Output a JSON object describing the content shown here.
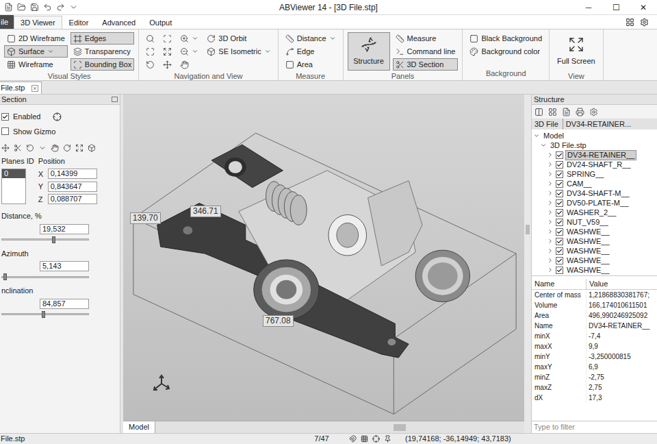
{
  "window": {
    "title": "ABViewer 14 - [3D File.stp]",
    "controls": [
      "─",
      "☐",
      "✕"
    ]
  },
  "tabs": [
    {
      "label": "ile",
      "selected": false,
      "kind": "file"
    },
    {
      "label": "3D Viewer",
      "selected": true,
      "kind": "tab"
    },
    {
      "label": "Editor",
      "selected": false,
      "kind": "tab"
    },
    {
      "label": "Advanced",
      "selected": false,
      "kind": "tab"
    },
    {
      "label": "Output",
      "selected": false,
      "kind": "tab"
    }
  ],
  "ribbon": [
    {
      "label": "Visual Styles",
      "columns": [
        [
          {
            "kind": "small",
            "label": "2D Wireframe",
            "selected": false,
            "dropdown": false
          },
          {
            "kind": "small",
            "label": "Surface",
            "selected": true,
            "dropdown": true
          },
          {
            "kind": "small",
            "label": "Wireframe",
            "selected": false,
            "dropdown": false
          }
        ],
        [
          {
            "kind": "small",
            "label": "Edges",
            "selected": true,
            "dropdown": false
          },
          {
            "kind": "small",
            "label": "Transparency",
            "selected": false,
            "dropdown": false
          },
          {
            "kind": "small",
            "label": "Bounding Box",
            "selected": true,
            "dropdown": false
          }
        ]
      ]
    },
    {
      "label": "Navigation and View",
      "columns": [
        [
          {
            "kind": "icon",
            "selected": false,
            "dropdown": false
          },
          {
            "kind": "icon",
            "selected": false,
            "dropdown": false
          },
          {
            "kind": "icon",
            "selected": false,
            "dropdown": false
          }
        ],
        [
          {
            "kind": "icon",
            "selected": false,
            "dropdown": false
          },
          {
            "kind": "icon",
            "selected": false,
            "dropdown": false
          },
          {
            "kind": "icon",
            "selected": false,
            "dropdown": false
          }
        ],
        [
          {
            "kind": "icon",
            "selected": false,
            "dropdown": true
          },
          {
            "kind": "icon",
            "selected": false,
            "dropdown": true
          },
          {
            "kind": "icon",
            "selected": false,
            "dropdown": false
          }
        ],
        [
          {
            "kind": "small",
            "label": "3D Orbit",
            "selected": false,
            "dropdown": false
          },
          {
            "kind": "small",
            "label": "SE Isometric",
            "selected": false,
            "dropdown": true
          }
        ]
      ]
    },
    {
      "label": "Measure",
      "columns": [
        [
          {
            "kind": "small",
            "label": "Distance",
            "selected": false,
            "dropdown": true
          },
          {
            "kind": "small",
            "label": "Edge",
            "selected": false,
            "dropdown": false
          },
          {
            "kind": "small",
            "label": "Area",
            "selected": false,
            "dropdown": false
          }
        ]
      ]
    },
    {
      "label": "Panels",
      "columns": [
        [
          {
            "kind": "large",
            "label": "Structure",
            "selected": true,
            "dropdown": false
          }
        ],
        [
          {
            "kind": "small",
            "label": "Measure",
            "selected": false,
            "dropdown": false
          },
          {
            "kind": "small",
            "label": "Command line",
            "selected": false,
            "dropdown": false
          },
          {
            "kind": "small",
            "label": "3D Section",
            "selected": true,
            "dropdown": false
          }
        ]
      ]
    },
    {
      "label": "Background",
      "columns": [
        [
          {
            "kind": "small",
            "label": "Black Background",
            "selected": false,
            "dropdown": false
          },
          {
            "kind": "small",
            "label": "Background color",
            "selected": false,
            "dropdown": false
          }
        ]
      ]
    },
    {
      "label": "View",
      "columns": [
        [
          {
            "kind": "large",
            "label": "Full Screen",
            "selected": false,
            "dropdown": false
          }
        ]
      ]
    }
  ],
  "document_tabs": [
    {
      "label": "File.stp",
      "selected": true
    }
  ],
  "section_panel": {
    "title": "Section",
    "options": [
      {
        "label": "Enabled",
        "checked": true
      },
      {
        "label": "Show Gizmo",
        "checked": false
      }
    ],
    "planes": {
      "label": "Planes ID",
      "items": [
        {
          "label": "0",
          "selected": true
        }
      ]
    },
    "position": {
      "label": "Position",
      "fields": [
        {
          "axis": "X",
          "value": "0,14399"
        },
        {
          "axis": "Y",
          "value": "0,843647"
        },
        {
          "axis": "Z",
          "value": "0,088707"
        }
      ]
    },
    "sliders": [
      {
        "label": "Distance, %",
        "value": "19,532",
        "level": 0.58
      },
      {
        "label": "Azimuth",
        "value": "5,143",
        "level": 0.02
      },
      {
        "label": "nclination",
        "value": "84,857",
        "level": 0.46
      }
    ]
  },
  "viewport": {
    "dimensions": [
      "139.70",
      "346.71",
      "767.08"
    ],
    "tabs": [
      {
        "label": "Model",
        "selected": true
      }
    ]
  },
  "structure_panel": {
    "title": "Structure",
    "breadcrumb": [
      "3D File",
      "DV34-RETAINER..."
    ],
    "tree": [
      {
        "label": "Model",
        "depth": 0,
        "expanded": true,
        "checkbox": false,
        "checked": false,
        "selected": false
      },
      {
        "label": "3D File.stp",
        "depth": 1,
        "expanded": true,
        "checkbox": false,
        "checked": false,
        "selected": false
      },
      {
        "label": "DV34-RETAINER__",
        "depth": 2,
        "expanded": false,
        "checkbox": true,
        "checked": true,
        "selected": true
      },
      {
        "label": "DV24-SHAFT_R__",
        "depth": 2,
        "expanded": false,
        "checkbox": true,
        "checked": true,
        "selected": false
      },
      {
        "label": "SPRING__",
        "depth": 2,
        "expanded": false,
        "checkbox": true,
        "checked": true,
        "selected": false
      },
      {
        "label": "CAM__",
        "depth": 2,
        "expanded": false,
        "checkbox": true,
        "checked": true,
        "selected": false
      },
      {
        "label": "DV34-SHAFT-M__",
        "depth": 2,
        "expanded": false,
        "checkbox": true,
        "checked": true,
        "selected": false
      },
      {
        "label": "DV50-PLATE-M__",
        "depth": 2,
        "expanded": false,
        "checkbox": true,
        "checked": true,
        "selected": false
      },
      {
        "label": "WASHER_2__",
        "depth": 2,
        "expanded": false,
        "checkbox": true,
        "checked": true,
        "selected": false
      },
      {
        "label": "NUT_V59__",
        "depth": 2,
        "expanded": false,
        "checkbox": true,
        "checked": true,
        "selected": false
      },
      {
        "label": "WASHWE__",
        "depth": 2,
        "expanded": false,
        "checkbox": true,
        "checked": true,
        "selected": false
      },
      {
        "label": "WASHWE__",
        "depth": 2,
        "expanded": false,
        "checkbox": true,
        "checked": true,
        "selected": false
      },
      {
        "label": "WASHWE__",
        "depth": 2,
        "expanded": false,
        "checkbox": true,
        "checked": true,
        "selected": false
      },
      {
        "label": "WASHWE__",
        "depth": 2,
        "expanded": false,
        "checkbox": true,
        "checked": true,
        "selected": false
      },
      {
        "label": "WASHWE__",
        "depth": 2,
        "expanded": false,
        "checkbox": true,
        "checked": true,
        "selected": false
      }
    ],
    "properties": {
      "columns": [
        "Name",
        "Value"
      ],
      "rows": [
        [
          "Center of mass",
          "1,21868830381767;"
        ],
        [
          "Volume",
          "166,174010611501"
        ],
        [
          "Area",
          "496,990246925092"
        ],
        [
          "Name",
          "DV34-RETAINER__"
        ],
        [
          "minX",
          "-7,4"
        ],
        [
          "maxX",
          "9,9"
        ],
        [
          "minY",
          "-3,250000815"
        ],
        [
          "maxY",
          "6,9"
        ],
        [
          "minZ",
          "-2,75"
        ],
        [
          "maxZ",
          "2,75"
        ],
        [
          "dX",
          "17,3"
        ]
      ]
    },
    "filter": {
      "placeholder": "Type to filter"
    }
  },
  "status_bar": {
    "file": "File.stp",
    "page": "7/47",
    "coordinates": "(19,74168; -36,14949; 43,7183)"
  }
}
